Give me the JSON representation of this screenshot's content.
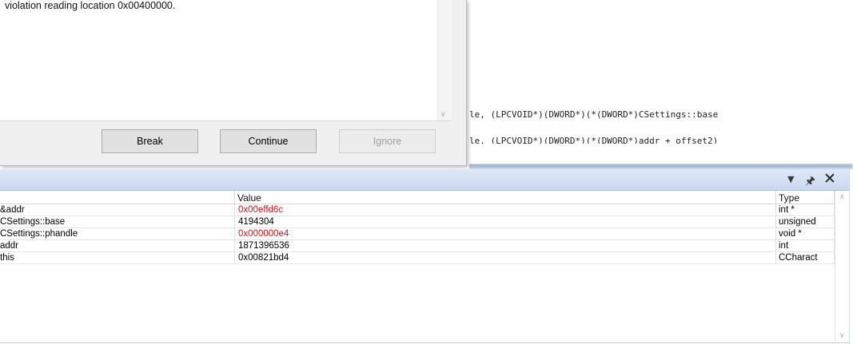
{
  "dialog": {
    "message": "violation reading location 0x00400000.",
    "buttons": {
      "break": "Break",
      "continue": "Continue",
      "ignore": "Ignore"
    }
  },
  "editor": {
    "lines": [
      "le, (LPCVOID*)(DWORD*)(*(DWORD*)CSettings::base",
      "le, (LPCVOID*)(DWORD*)(*(DWORD*)addr + offset2)"
    ]
  },
  "panel": {
    "columns": {
      "name": "",
      "value": "Value",
      "type": "Type"
    },
    "rows": [
      {
        "name": "&addr",
        "value": "0x00effd6c",
        "type": "int *",
        "changed": true
      },
      {
        "name": "CSettings::base",
        "value": "4194304",
        "type": "unsigned",
        "changed": false
      },
      {
        "name": "CSettings::phandle",
        "value": "0x000000e4",
        "type": "void *",
        "changed": true
      },
      {
        "name": "addr",
        "value": "1871396536",
        "type": "int",
        "changed": false
      },
      {
        "name": "this",
        "value": "0x00821bd4",
        "type": "CCharact",
        "changed": false
      }
    ],
    "changed_color": "#e01010"
  }
}
